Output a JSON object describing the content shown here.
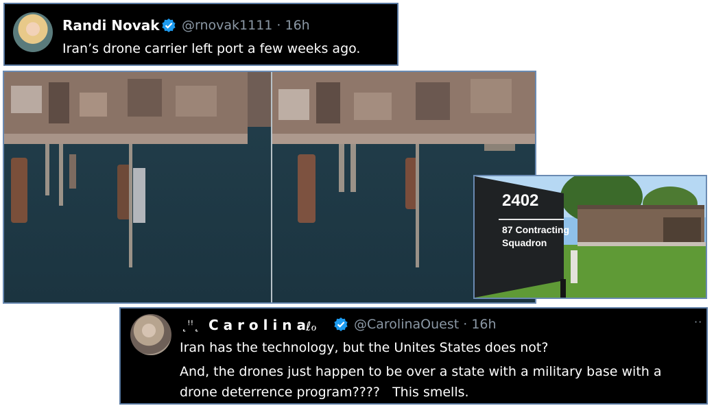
{
  "tweet1": {
    "name": "Randi Novak",
    "handle": "@rnovak1111 · 16h",
    "text": "Iran’s drone carrier left port a few weeks ago."
  },
  "sign": {
    "number": "2402",
    "line1": "87 Contracting",
    "line2": "Squadron"
  },
  "tweet2": {
    "name_prefix": "˛ꜝꜝ˛",
    "name": "C a r o l i n a",
    "name_suffix": "ℓℴ",
    "handle": "@CarolinaOuest · 16h",
    "line1": "Iran has the technology, but the Unites States does not?",
    "line2": "And, the drones just happen to be over a state with a military base with a",
    "line3": "drone deterrence program????   This smells."
  },
  "colors": {
    "verified": "#1d9bf0",
    "handle": "#8b98a5",
    "border": "#5878a0"
  }
}
